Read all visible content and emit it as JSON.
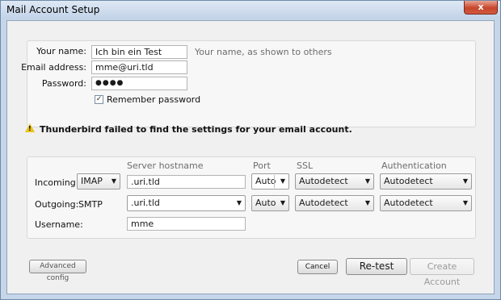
{
  "window": {
    "title": "Mail Account Setup",
    "close_glyph": "x"
  },
  "identity": {
    "name_label": "Your name:",
    "name_value": "Ich bin ein Test",
    "name_hint": "Your name, as shown to others",
    "email_label": "Email address:",
    "email_value": "mme@uri.tld",
    "password_label": "Password:",
    "password_value": "●●●●",
    "remember_label": "Remember password",
    "remember_checked": true
  },
  "warning": {
    "message": "Thunderbird failed to find the settings for your email account."
  },
  "servers": {
    "col_hostname": "Server hostname",
    "col_port": "Port",
    "col_ssl": "SSL",
    "col_auth": "Authentication",
    "incoming_label": "Incoming:",
    "incoming_protocol": "IMAP",
    "incoming_hostname": ".uri.tld",
    "incoming_port": "Auto",
    "incoming_ssl": "Autodetect",
    "incoming_auth": "Autodetect",
    "outgoing_label": "Outgoing:",
    "outgoing_protocol": "SMTP",
    "outgoing_hostname": ".uri.tld",
    "outgoing_port": "Auto",
    "outgoing_ssl": "Autodetect",
    "outgoing_auth": "Autodetect",
    "username_label": "Username:",
    "username_value": "mme"
  },
  "footer": {
    "advanced_config": "Advanced config",
    "cancel": "Cancel",
    "retest": "Re-test",
    "create_account": "Create Account"
  }
}
